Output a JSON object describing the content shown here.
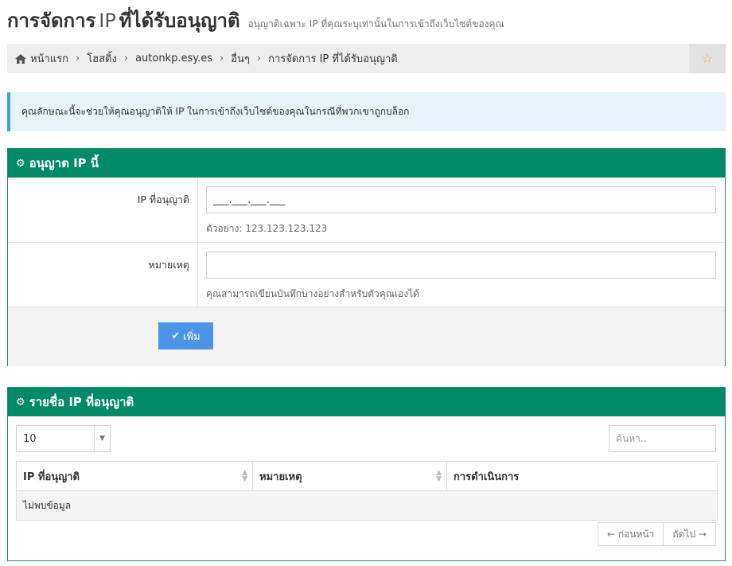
{
  "header": {
    "title_part1": "การจัดการ",
    "title_part2": "IP",
    "title_part3": "ที่ได้รับอนุญาติ",
    "subtitle": "อนุญาติเฉพาะ IP ที่คุณระบุเท่านั้นในการเข้าถึงเว็บไซต์ของคุณ"
  },
  "breadcrumb": {
    "items": [
      "หน้าแรก",
      "โฮสติ้ง",
      "autonkp.esy.es",
      "อื่นๆ",
      "การจัดการ IP ที่ได้รับอนุญาติ"
    ],
    "separator": "›",
    "star_icon": "☆"
  },
  "callout": {
    "text": "คุณลักษณะนี้จะช่วยให้คุณอนุญาติให้ IP ในการเข้าถึงเว็บไซต์ของคุณในกรณีที่พวกเขาถูกบล็อก"
  },
  "allow_panel": {
    "title": "อนุญาต IP นี้",
    "ip_label": "IP ที่อนุญาติ",
    "ip_value": "___.___.___.___",
    "ip_help": "ตัวอย่าง: 123.123.123.123",
    "note_label": "หมายเหตุ",
    "note_value": "",
    "note_help": "คุณสามารถเขียนบันทึกบางอย่างสำหรับตัวคุณเองได้",
    "add_button": "เพิ่ม"
  },
  "list_panel": {
    "title": "รายชื่อ IP ที่อนุญาติ",
    "page_size": "10",
    "search_placeholder": "ค้นหา..",
    "columns": [
      "IP ที่อนุญาติ",
      "หมายเหตุ",
      "การดำเนินการ"
    ],
    "empty_text": "ไม่พบข้อมูล",
    "prev_label": "← ก่อนหน้า",
    "next_label": "ถัดไป →"
  },
  "colors": {
    "panel_header": "#008a68",
    "add_button": "#4d94e8",
    "callout_border": "#3ba3d8",
    "star": "#f0ad4e"
  }
}
